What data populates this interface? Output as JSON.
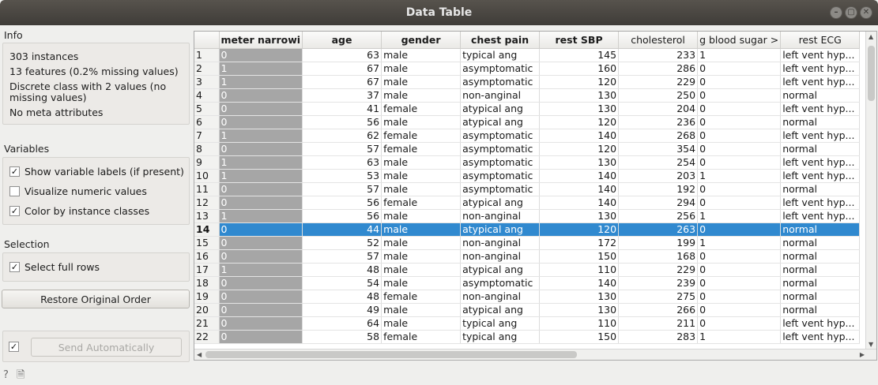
{
  "window": {
    "title": "Data Table"
  },
  "info": {
    "title": "Info",
    "lines": [
      "303 instances",
      "13 features (0.2% missing values)",
      "Discrete class with 2 values (no",
      "missing values)",
      "No meta attributes"
    ]
  },
  "variables": {
    "title": "Variables",
    "show_labels": "Show variable labels (if present)",
    "visualize_numeric": "Visualize numeric values",
    "color_by_class": "Color by instance classes"
  },
  "selection": {
    "title": "Selection",
    "select_full_rows": "Select full rows"
  },
  "buttons": {
    "restore": "Restore Original Order",
    "send": "Send Automatically"
  },
  "table": {
    "columns": [
      "meter narrowi",
      "age",
      "gender",
      "chest pain",
      "rest SBP",
      "cholesterol",
      "g blood sugar >",
      "rest ECG"
    ],
    "selected_row": 14,
    "rows": [
      [
        "1",
        "0",
        "63",
        "male",
        "typical ang",
        "145",
        "233",
        "1",
        "left vent hyp..."
      ],
      [
        "2",
        "1",
        "67",
        "male",
        "asymptomatic",
        "160",
        "286",
        "0",
        "left vent hyp..."
      ],
      [
        "3",
        "1",
        "67",
        "male",
        "asymptomatic",
        "120",
        "229",
        "0",
        "left vent hyp..."
      ],
      [
        "4",
        "0",
        "37",
        "male",
        "non-anginal",
        "130",
        "250",
        "0",
        "normal"
      ],
      [
        "5",
        "0",
        "41",
        "female",
        "atypical ang",
        "130",
        "204",
        "0",
        "left vent hyp..."
      ],
      [
        "6",
        "0",
        "56",
        "male",
        "atypical ang",
        "120",
        "236",
        "0",
        "normal"
      ],
      [
        "7",
        "1",
        "62",
        "female",
        "asymptomatic",
        "140",
        "268",
        "0",
        "left vent hyp..."
      ],
      [
        "8",
        "0",
        "57",
        "female",
        "asymptomatic",
        "120",
        "354",
        "0",
        "normal"
      ],
      [
        "9",
        "1",
        "63",
        "male",
        "asymptomatic",
        "130",
        "254",
        "0",
        "left vent hyp..."
      ],
      [
        "10",
        "1",
        "53",
        "male",
        "asymptomatic",
        "140",
        "203",
        "1",
        "left vent hyp..."
      ],
      [
        "11",
        "0",
        "57",
        "male",
        "asymptomatic",
        "140",
        "192",
        "0",
        "normal"
      ],
      [
        "12",
        "0",
        "56",
        "female",
        "atypical ang",
        "140",
        "294",
        "0",
        "left vent hyp..."
      ],
      [
        "13",
        "1",
        "56",
        "male",
        "non-anginal",
        "130",
        "256",
        "1",
        "left vent hyp..."
      ],
      [
        "14",
        "0",
        "44",
        "male",
        "atypical ang",
        "120",
        "263",
        "0",
        "normal"
      ],
      [
        "15",
        "0",
        "52",
        "male",
        "non-anginal",
        "172",
        "199",
        "1",
        "normal"
      ],
      [
        "16",
        "0",
        "57",
        "male",
        "non-anginal",
        "150",
        "168",
        "0",
        "normal"
      ],
      [
        "17",
        "1",
        "48",
        "male",
        "atypical ang",
        "110",
        "229",
        "0",
        "normal"
      ],
      [
        "18",
        "0",
        "54",
        "male",
        "asymptomatic",
        "140",
        "239",
        "0",
        "normal"
      ],
      [
        "19",
        "0",
        "48",
        "female",
        "non-anginal",
        "130",
        "275",
        "0",
        "normal"
      ],
      [
        "20",
        "0",
        "49",
        "male",
        "atypical ang",
        "130",
        "266",
        "0",
        "normal"
      ],
      [
        "21",
        "0",
        "64",
        "male",
        "typical ang",
        "110",
        "211",
        "0",
        "left vent hyp..."
      ],
      [
        "22",
        "0",
        "58",
        "female",
        "typical ang",
        "150",
        "283",
        "1",
        "left vent hyp..."
      ]
    ]
  },
  "colors": {
    "selection": "#3089cf",
    "class_cell": "#a6a6a6"
  }
}
